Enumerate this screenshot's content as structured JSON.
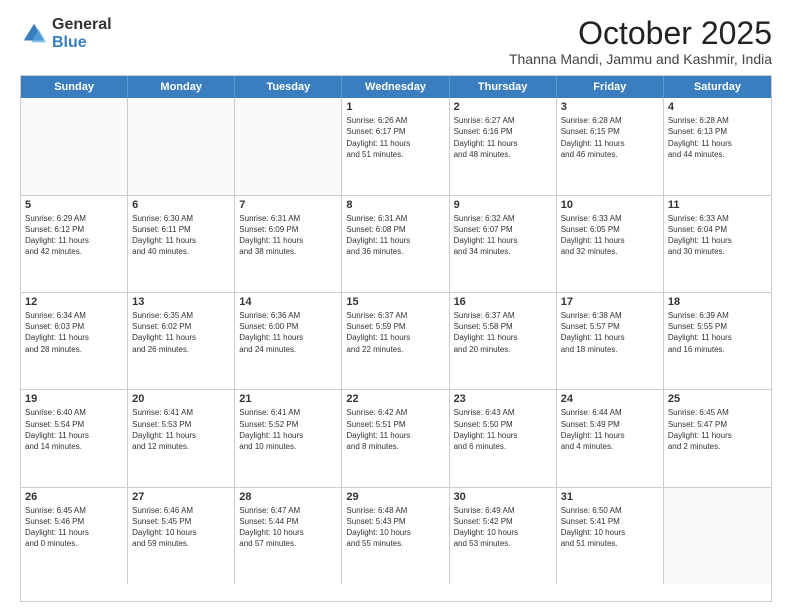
{
  "logo": {
    "general": "General",
    "blue": "Blue"
  },
  "title": "October 2025",
  "location": "Thanna Mandi, Jammu and Kashmir, India",
  "days": [
    "Sunday",
    "Monday",
    "Tuesday",
    "Wednesday",
    "Thursday",
    "Friday",
    "Saturday"
  ],
  "weeks": [
    [
      {
        "day": "",
        "text": ""
      },
      {
        "day": "",
        "text": ""
      },
      {
        "day": "",
        "text": ""
      },
      {
        "day": "1",
        "text": "Sunrise: 6:26 AM\nSunset: 6:17 PM\nDaylight: 11 hours\nand 51 minutes."
      },
      {
        "day": "2",
        "text": "Sunrise: 6:27 AM\nSunset: 6:16 PM\nDaylight: 11 hours\nand 48 minutes."
      },
      {
        "day": "3",
        "text": "Sunrise: 6:28 AM\nSunset: 6:15 PM\nDaylight: 11 hours\nand 46 minutes."
      },
      {
        "day": "4",
        "text": "Sunrise: 6:28 AM\nSunset: 6:13 PM\nDaylight: 11 hours\nand 44 minutes."
      }
    ],
    [
      {
        "day": "5",
        "text": "Sunrise: 6:29 AM\nSunset: 6:12 PM\nDaylight: 11 hours\nand 42 minutes."
      },
      {
        "day": "6",
        "text": "Sunrise: 6:30 AM\nSunset: 6:11 PM\nDaylight: 11 hours\nand 40 minutes."
      },
      {
        "day": "7",
        "text": "Sunrise: 6:31 AM\nSunset: 6:09 PM\nDaylight: 11 hours\nand 38 minutes."
      },
      {
        "day": "8",
        "text": "Sunrise: 6:31 AM\nSunset: 6:08 PM\nDaylight: 11 hours\nand 36 minutes."
      },
      {
        "day": "9",
        "text": "Sunrise: 6:32 AM\nSunset: 6:07 PM\nDaylight: 11 hours\nand 34 minutes."
      },
      {
        "day": "10",
        "text": "Sunrise: 6:33 AM\nSunset: 6:05 PM\nDaylight: 11 hours\nand 32 minutes."
      },
      {
        "day": "11",
        "text": "Sunrise: 6:33 AM\nSunset: 6:04 PM\nDaylight: 11 hours\nand 30 minutes."
      }
    ],
    [
      {
        "day": "12",
        "text": "Sunrise: 6:34 AM\nSunset: 6:03 PM\nDaylight: 11 hours\nand 28 minutes."
      },
      {
        "day": "13",
        "text": "Sunrise: 6:35 AM\nSunset: 6:02 PM\nDaylight: 11 hours\nand 26 minutes."
      },
      {
        "day": "14",
        "text": "Sunrise: 6:36 AM\nSunset: 6:00 PM\nDaylight: 11 hours\nand 24 minutes."
      },
      {
        "day": "15",
        "text": "Sunrise: 6:37 AM\nSunset: 5:59 PM\nDaylight: 11 hours\nand 22 minutes."
      },
      {
        "day": "16",
        "text": "Sunrise: 6:37 AM\nSunset: 5:58 PM\nDaylight: 11 hours\nand 20 minutes."
      },
      {
        "day": "17",
        "text": "Sunrise: 6:38 AM\nSunset: 5:57 PM\nDaylight: 11 hours\nand 18 minutes."
      },
      {
        "day": "18",
        "text": "Sunrise: 6:39 AM\nSunset: 5:55 PM\nDaylight: 11 hours\nand 16 minutes."
      }
    ],
    [
      {
        "day": "19",
        "text": "Sunrise: 6:40 AM\nSunset: 5:54 PM\nDaylight: 11 hours\nand 14 minutes."
      },
      {
        "day": "20",
        "text": "Sunrise: 6:41 AM\nSunset: 5:53 PM\nDaylight: 11 hours\nand 12 minutes."
      },
      {
        "day": "21",
        "text": "Sunrise: 6:41 AM\nSunset: 5:52 PM\nDaylight: 11 hours\nand 10 minutes."
      },
      {
        "day": "22",
        "text": "Sunrise: 6:42 AM\nSunset: 5:51 PM\nDaylight: 11 hours\nand 8 minutes."
      },
      {
        "day": "23",
        "text": "Sunrise: 6:43 AM\nSunset: 5:50 PM\nDaylight: 11 hours\nand 6 minutes."
      },
      {
        "day": "24",
        "text": "Sunrise: 6:44 AM\nSunset: 5:49 PM\nDaylight: 11 hours\nand 4 minutes."
      },
      {
        "day": "25",
        "text": "Sunrise: 6:45 AM\nSunset: 5:47 PM\nDaylight: 11 hours\nand 2 minutes."
      }
    ],
    [
      {
        "day": "26",
        "text": "Sunrise: 6:45 AM\nSunset: 5:46 PM\nDaylight: 11 hours\nand 0 minutes."
      },
      {
        "day": "27",
        "text": "Sunrise: 6:46 AM\nSunset: 5:45 PM\nDaylight: 10 hours\nand 59 minutes."
      },
      {
        "day": "28",
        "text": "Sunrise: 6:47 AM\nSunset: 5:44 PM\nDaylight: 10 hours\nand 57 minutes."
      },
      {
        "day": "29",
        "text": "Sunrise: 6:48 AM\nSunset: 5:43 PM\nDaylight: 10 hours\nand 55 minutes."
      },
      {
        "day": "30",
        "text": "Sunrise: 6:49 AM\nSunset: 5:42 PM\nDaylight: 10 hours\nand 53 minutes."
      },
      {
        "day": "31",
        "text": "Sunrise: 6:50 AM\nSunset: 5:41 PM\nDaylight: 10 hours\nand 51 minutes."
      },
      {
        "day": "",
        "text": ""
      }
    ]
  ]
}
